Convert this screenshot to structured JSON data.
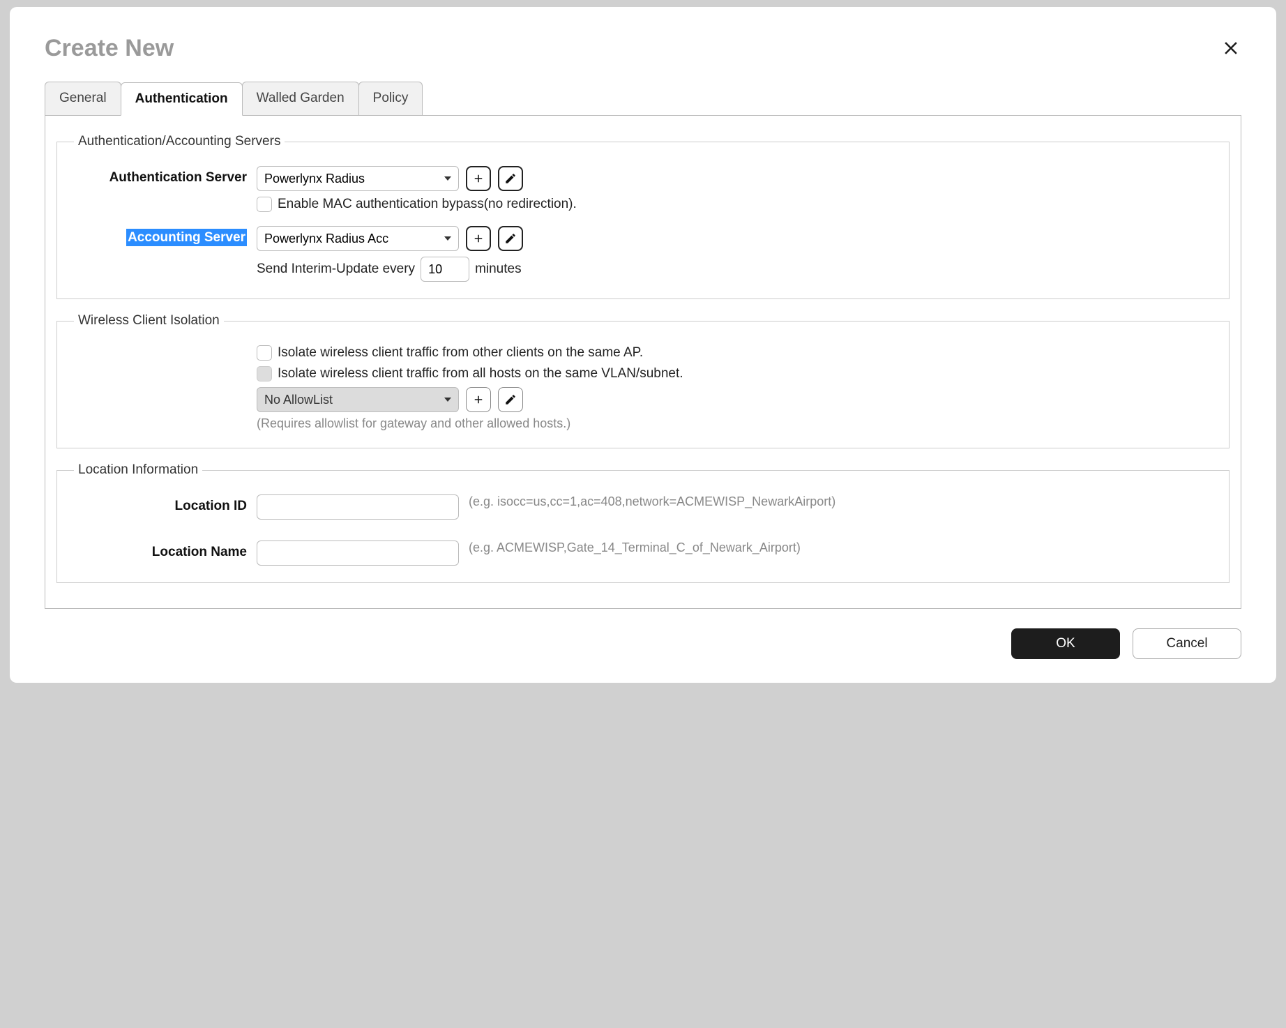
{
  "modal": {
    "title": "Create New"
  },
  "tabs": {
    "general": "General",
    "authentication": "Authentication",
    "walled_garden": "Walled Garden",
    "policy": "Policy"
  },
  "auth_servers": {
    "legend": "Authentication/Accounting Servers",
    "auth_label": "Authentication Server",
    "auth_value": "Powerlynx Radius",
    "mac_bypass_label": "Enable MAC authentication bypass(no redirection).",
    "acct_label": "Accounting Server",
    "acct_value": "Powerlynx Radius Acc",
    "interim_prefix": "Send Interim-Update every",
    "interim_value": "10",
    "interim_suffix": "minutes"
  },
  "isolation": {
    "legend": "Wireless Client Isolation",
    "same_ap_label": "Isolate wireless client traffic from other clients on the same AP.",
    "vlan_label": "Isolate wireless client traffic from all hosts on the same VLAN/subnet.",
    "allowlist_value": "No AllowList",
    "allowlist_hint": "(Requires allowlist for gateway and other allowed hosts.)"
  },
  "location": {
    "legend": "Location Information",
    "id_label": "Location ID",
    "id_hint": "(e.g. isocc=us,cc=1,ac=408,network=ACMEWISP_NewarkAirport)",
    "name_label": "Location Name",
    "name_hint": "(e.g. ACMEWISP,Gate_14_Terminal_C_of_Newark_Airport)"
  },
  "footer": {
    "ok": "OK",
    "cancel": "Cancel"
  }
}
